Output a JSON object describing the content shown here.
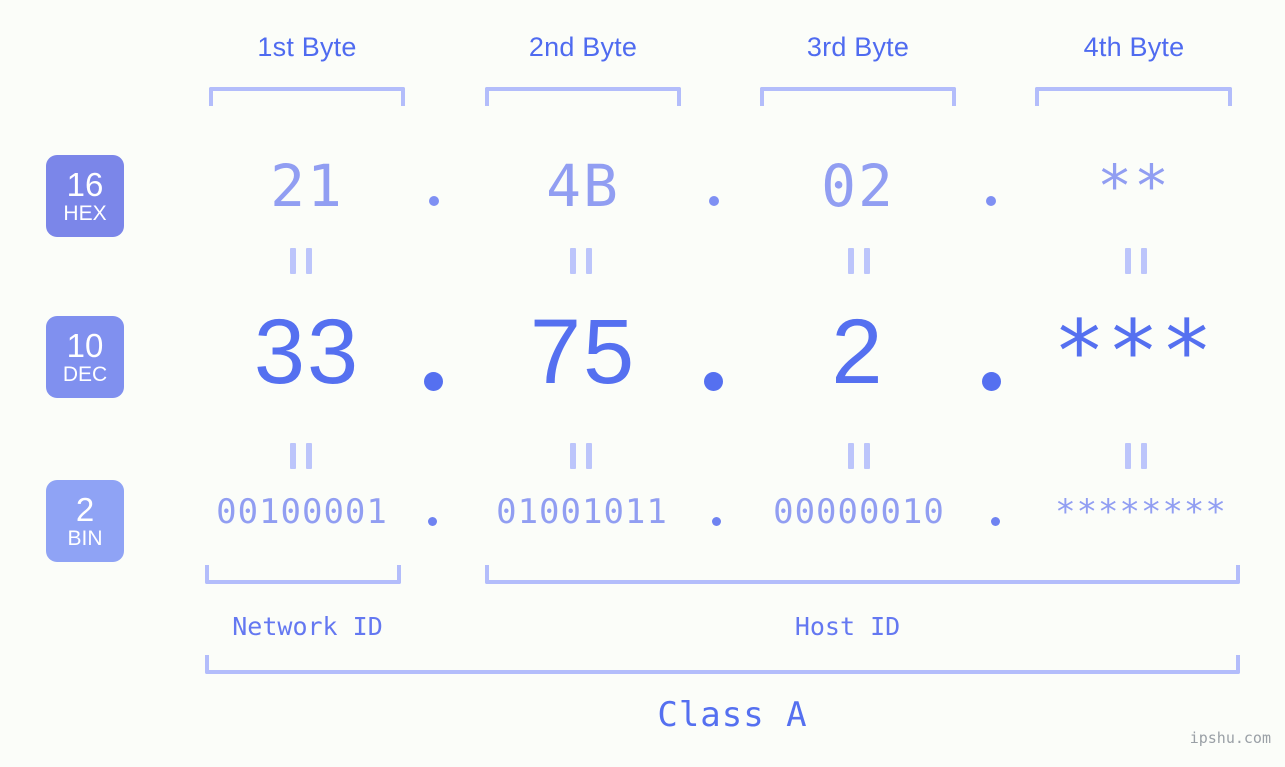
{
  "page": {
    "background_color": "#fbfdf9",
    "accent_color": "#5570f0",
    "light_accent_color": "#b3bdfb",
    "watermark": "ipshu.com"
  },
  "byte_headers": [
    {
      "label": "1st Byte"
    },
    {
      "label": "2nd Byte"
    },
    {
      "label": "3rd Byte"
    },
    {
      "label": "4th Byte"
    }
  ],
  "rows": [
    {
      "key": "hex",
      "badge_number": "16",
      "badge_name": "HEX",
      "badge_color": "#7b86e9",
      "values": [
        "21",
        "4B",
        "02",
        "**"
      ]
    },
    {
      "key": "dec",
      "badge_number": "10",
      "badge_name": "DEC",
      "badge_color": "#8090ef",
      "values": [
        "33",
        "75",
        "2",
        "***"
      ]
    },
    {
      "key": "bin",
      "badge_number": "2",
      "badge_name": "BIN",
      "badge_color": "#8fa3f5",
      "values": [
        "00100001",
        "01001011",
        "00000010",
        "********"
      ]
    }
  ],
  "separators": {
    "dot": ".",
    "equals": "="
  },
  "segments": {
    "network_id": "Network ID",
    "host_id": "Host ID",
    "class": "Class A"
  }
}
